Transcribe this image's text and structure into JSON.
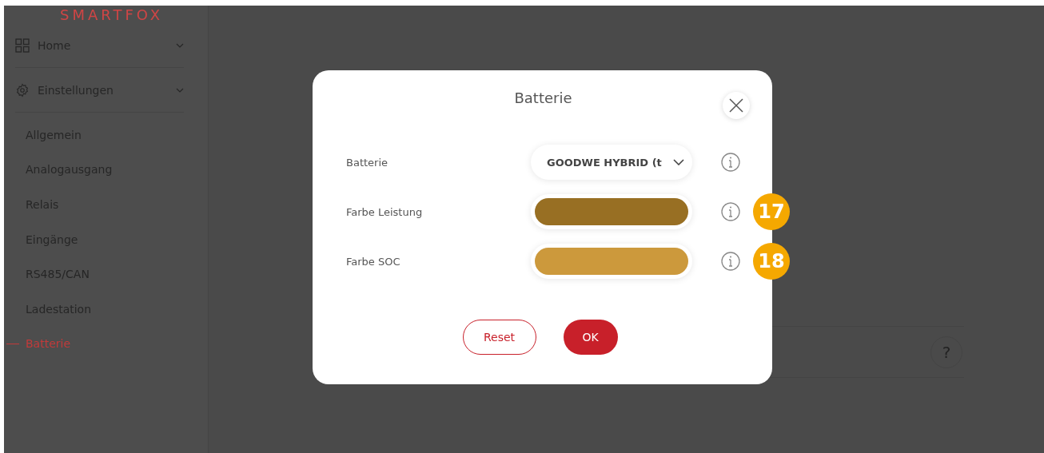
{
  "logo": "SMARTFOX",
  "sidebar": {
    "sections": [
      {
        "label": "Home"
      },
      {
        "label": "Einstellungen"
      }
    ],
    "items": [
      {
        "label": "Allgemein",
        "selected": false
      },
      {
        "label": "Analogausgang",
        "selected": false
      },
      {
        "label": "Relais",
        "selected": false
      },
      {
        "label": "Eingänge",
        "selected": false
      },
      {
        "label": "RS485/CAN",
        "selected": false
      },
      {
        "label": "Ladestation",
        "selected": false
      },
      {
        "label": "Batterie",
        "selected": true
      }
    ]
  },
  "help_button": "?",
  "dialog": {
    "title": "Batterie",
    "fields": [
      {
        "kind": "select",
        "label": "Batterie",
        "value": "GOODWE HYBRID (t"
      },
      {
        "kind": "color",
        "label": "Farbe Leistung",
        "color": "#986f23",
        "badge": "17"
      },
      {
        "kind": "color",
        "label": "Farbe SOC",
        "color": "#cc993c",
        "badge": "18"
      }
    ],
    "buttons": [
      {
        "kind": "secondary",
        "label": "Reset"
      },
      {
        "kind": "primary",
        "label": "OK"
      }
    ]
  }
}
